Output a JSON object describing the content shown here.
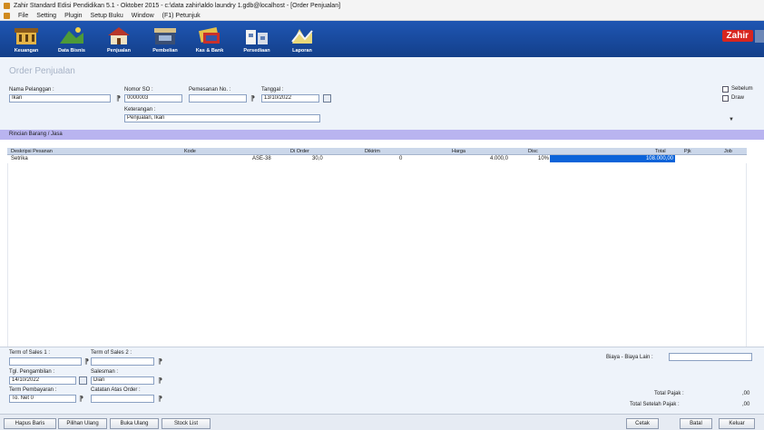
{
  "window": {
    "title": "Zahir Standard Edisi Pendidikan 5.1 - Oktober 2015 - c:\\data zahir\\aldo laundry 1.gdb@localhost - [Order Penjualan]"
  },
  "menu": [
    "File",
    "Setting",
    "Plugin",
    "Setup Buku",
    "Window",
    "(F1) Petunjuk"
  ],
  "toolbar": {
    "buttons": [
      {
        "label": "Keuangan",
        "icon": "building-icon"
      },
      {
        "label": "Data Bisnis",
        "icon": "landscape-icon"
      },
      {
        "label": "Penjualan",
        "icon": "house-icon"
      },
      {
        "label": "Pembelian",
        "icon": "shop-icon"
      },
      {
        "label": "Kas & Bank",
        "icon": "money-icon"
      },
      {
        "label": "Persediaan",
        "icon": "warehouse-icon"
      },
      {
        "label": "Laporan",
        "icon": "report-icon"
      }
    ],
    "brand": "Zahir"
  },
  "form": {
    "title": "Order Penjualan",
    "customer_label": "Nama Pelanggan :",
    "customer_value": "Ikan",
    "so_label": "Nomor SO :",
    "so_value": "0000003",
    "po_label": "Pemesanan No. :",
    "po_value": "",
    "date_label": "Tanggal :",
    "date_value": "13/10/2022",
    "note_label": "Keterangan :",
    "note_value": "Penjualan, Ikan",
    "option1_label": "Sebelum",
    "option2_label": "Draw"
  },
  "detail": {
    "section_title": "Rincian Barang / Jasa",
    "columns": [
      "Deskripsi Pesanan",
      "Kode",
      "Di Order",
      "Dikirim",
      "Harga",
      "Disc",
      "Total",
      "Pjk",
      "Job"
    ],
    "rows": [
      {
        "desc": "Setrika",
        "kode": "ASE-38",
        "order": "30,0",
        "dikirim": "0",
        "harga": "4.000,0",
        "disc": "10%",
        "total": "108.000,00",
        "pjk": "",
        "job": ""
      }
    ]
  },
  "footer": {
    "term1_label": "Term of Sales 1 :",
    "term2_label": "Term of Sales 2 :",
    "ship_date_label": "Tgl. Pengambilan :",
    "ship_date_value": "14/10/2022",
    "salesman_label": "Salesman :",
    "salesman_value": "Dian",
    "payment_label": "Term Pembayaran :",
    "payment_value": "To. Net 0",
    "order_note_label": "Catatan Atas Order :",
    "note_right_label": "Biaya - Biaya Lain :",
    "tax_label": "Total Pajak :",
    "tax_value": ",00",
    "grand_label": "Total Setelah Pajak :",
    "grand_value": ",00"
  },
  "status_buttons": [
    "Hapus Baris",
    "Pilihan Ulang",
    "Buka Ulang",
    "Stock List"
  ],
  "actions": {
    "print": "Cetak",
    "save": "Batal",
    "exit": "Keluar"
  }
}
